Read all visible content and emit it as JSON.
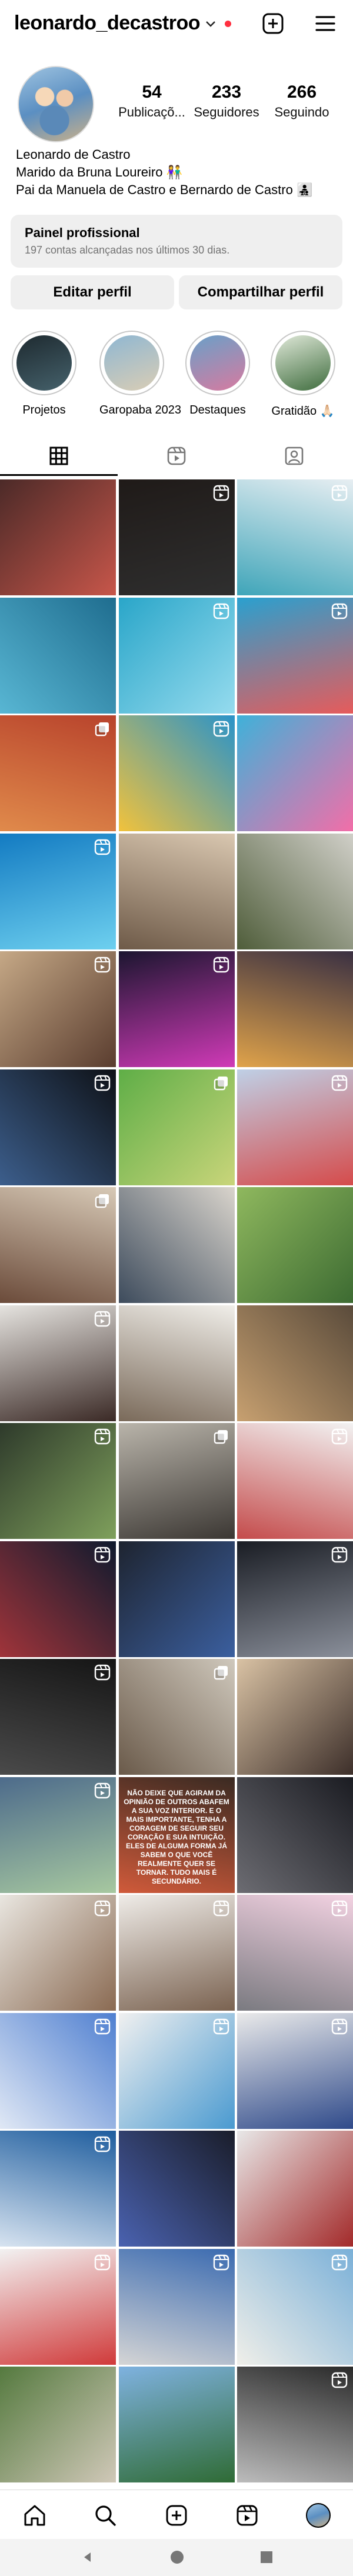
{
  "header": {
    "username": "leonardo_decastroo",
    "icons": [
      "chevron-down-icon",
      "create-plus-icon",
      "menu-icon"
    ]
  },
  "profile": {
    "stats": [
      {
        "value": "54",
        "label": "Publicaçõ..."
      },
      {
        "value": "233",
        "label": "Seguidores"
      },
      {
        "value": "266",
        "label": "Seguindo"
      }
    ],
    "name": "Leonardo de Castro",
    "bio_lines": [
      "Marido da Bruna Loureiro 👫",
      "Pai da Manuela de Castro e Bernardo de Castro 👨‍👧‍👦"
    ]
  },
  "professional_dashboard": {
    "title": "Painel profissional",
    "subtitle": "197 contas alcançadas nos últimos 30 dias."
  },
  "buttons": {
    "edit": "Editar perfil",
    "share": "Compartilhar perfil"
  },
  "highlights": [
    {
      "label": "Projetos",
      "colors": [
        "#1e2a30",
        "#45616b"
      ]
    },
    {
      "label": "Garopaba 2023",
      "colors": [
        "#8fb7d2",
        "#d9cdb5"
      ]
    },
    {
      "label": "Destaques",
      "colors": [
        "#6aa0c8",
        "#d77aa0"
      ]
    },
    {
      "label": "Gratidão 🙏🏻",
      "colors": [
        "#dfe8d8",
        "#3f6d3e"
      ]
    }
  ],
  "tabs": [
    "grid-icon",
    "reels-icon",
    "tagged-icon"
  ],
  "posts": [
    {
      "colors": [
        "#4c2a28",
        "#c7564a"
      ],
      "badge": null
    },
    {
      "colors": [
        "#1f1a18",
        "#2f2f2f"
      ],
      "badge": "reel"
    },
    {
      "colors": [
        "#e7eef2",
        "#3fa5b9"
      ],
      "badge": "reel"
    },
    {
      "colors": [
        "#1f6d8f",
        "#58b6d3"
      ],
      "badge": null
    },
    {
      "colors": [
        "#2aa6c9",
        "#95dbee"
      ],
      "badge": "reel"
    },
    {
      "colors": [
        "#2aa0cf",
        "#e65b5b"
      ],
      "badge": "reel"
    },
    {
      "colors": [
        "#b8432c",
        "#e08a4b"
      ],
      "badge": "carousel"
    },
    {
      "colors": [
        "#2a93c9",
        "#f1c23c"
      ],
      "badge": "reel"
    },
    {
      "colors": [
        "#3fb1d9",
        "#f26ea8"
      ],
      "badge": null
    },
    {
      "colors": [
        "#137bc2",
        "#6ed0ef"
      ],
      "badge": "reel"
    },
    {
      "colors": [
        "#d9c7b0",
        "#6e5a48"
      ],
      "badge": null
    },
    {
      "colors": [
        "#d0cfc8",
        "#4f5d3a"
      ],
      "badge": null
    },
    {
      "colors": [
        "#c5a886",
        "#5a3d2f"
      ],
      "badge": "reel"
    },
    {
      "colors": [
        "#1c1630",
        "#d03ab7"
      ],
      "badge": "reel"
    },
    {
      "colors": [
        "#3a3042",
        "#e0a34a"
      ],
      "badge": null
    },
    {
      "colors": [
        "#0e1116",
        "#3c5e8c"
      ],
      "badge": "reel"
    },
    {
      "colors": [
        "#5fae47",
        "#c9d57a"
      ],
      "badge": "carousel"
    },
    {
      "colors": [
        "#bfd0e6",
        "#d54b4b"
      ],
      "badge": "reel"
    },
    {
      "colors": [
        "#d7c9b6",
        "#6b4b3a"
      ],
      "badge": "carousel"
    },
    {
      "colors": [
        "#d9d4cc",
        "#3d4b5c"
      ],
      "badge": null
    },
    {
      "colors": [
        "#8fb85e",
        "#3d6b32"
      ],
      "badge": null
    },
    {
      "colors": [
        "#e5e3df",
        "#3b2a26"
      ],
      "badge": "reel"
    },
    {
      "colors": [
        "#f0eee9",
        "#7a6a5a"
      ],
      "badge": null
    },
    {
      "colors": [
        "#5a4b3b",
        "#c7a070"
      ],
      "badge": null
    },
    {
      "colors": [
        "#2e3a2b",
        "#7fa05c"
      ],
      "badge": "reel"
    },
    {
      "colors": [
        "#b9b4aa",
        "#3b3733"
      ],
      "badge": "carousel"
    },
    {
      "colors": [
        "#f2f2f2",
        "#c44b4b"
      ],
      "badge": "reel"
    },
    {
      "colors": [
        "#0f1a2e",
        "#a0343a"
      ],
      "badge": "reel"
    },
    {
      "colors": [
        "#1e2430",
        "#3b5f9f"
      ],
      "badge": null
    },
    {
      "colors": [
        "#1a1d24",
        "#8a8f9a"
      ],
      "badge": "reel"
    },
    {
      "colors": [
        "#151515",
        "#4a4a4a"
      ],
      "badge": "reel"
    },
    {
      "colors": [
        "#cfc8bc",
        "#6a5a4a"
      ],
      "badge": "carousel"
    },
    {
      "colors": [
        "#d9c2a4",
        "#3d2f2a"
      ],
      "badge": null
    },
    {
      "colors": [
        "#4d6b8b",
        "#a7c8a0"
      ],
      "badge": "reel"
    },
    {
      "colors": [
        "#3a2a22",
        "#d05a3a"
      ],
      "badge": null,
      "text": "NÃO DEIXE QUE AGIRAM DA OPINIÃO DE OUTROS ABAFEM A SUA VOZ INTERIOR. E O MAIS IMPORTANTE, TENHA A CORAGEM DE SEGUIR SEU CORAÇÃO E SUA INTUIÇÃO. ELES DE ALGUMA FORMA JÁ SABEM O QUE VOCÊ REALMENTE QUER SE TORNAR. TUDO MAIS É SECUNDÁRIO."
    },
    {
      "colors": [
        "#1b1c22",
        "#6c6c72"
      ],
      "badge": null
    },
    {
      "colors": [
        "#e9e6e0",
        "#8a6a52"
      ],
      "badge": "reel"
    },
    {
      "colors": [
        "#efece8",
        "#7a6250"
      ],
      "badge": "reel"
    },
    {
      "colors": [
        "#f3d2e2",
        "#7a7a80"
      ],
      "badge": "reel"
    },
    {
      "colors": [
        "#4f7fd0",
        "#e0e8f5"
      ],
      "badge": "reel"
    },
    {
      "colors": [
        "#f0f0f0",
        "#4a9ad0"
      ],
      "badge": "reel"
    },
    {
      "colors": [
        "#eaeaea",
        "#2f4a8a"
      ],
      "badge": "reel"
    },
    {
      "colors": [
        "#1e5d9e",
        "#d7e3f0"
      ],
      "badge": "reel"
    },
    {
      "colors": [
        "#1a1d2a",
        "#4a62b0"
      ],
      "badge": null
    },
    {
      "colors": [
        "#e8e8e8",
        "#a32a2a"
      ],
      "badge": null
    },
    {
      "colors": [
        "#f2f2f2",
        "#d03a3a"
      ],
      "badge": "reel"
    },
    {
      "colors": [
        "#3a6ab0",
        "#d5d5d5"
      ],
      "badge": "reel"
    },
    {
      "colors": [
        "#7ab0d8",
        "#f0efe9"
      ],
      "badge": "reel"
    },
    {
      "colors": [
        "#557a3f",
        "#d0c8b8"
      ],
      "badge": null
    },
    {
      "colors": [
        "#7fb2e0",
        "#2f6b35"
      ],
      "badge": null
    },
    {
      "colors": [
        "#2a2a2a",
        "#bcbcbc"
      ],
      "badge": "reel"
    }
  ],
  "bottom_nav": [
    "home-icon",
    "search-icon",
    "create-icon",
    "reels-icon",
    "profile-avatar"
  ]
}
